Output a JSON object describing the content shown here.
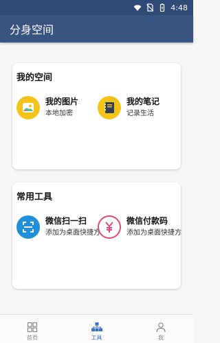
{
  "status_bar": {
    "time": "4:48",
    "icons": [
      "wifi-icon",
      "no-sim-icon",
      "battery-icon"
    ]
  },
  "app_bar": {
    "title": "分身空间"
  },
  "my_space": {
    "title": "我的空间",
    "items": [
      {
        "title": "我的图片",
        "subtitle": "本地加密",
        "icon": "photo-icon",
        "color": "#f3c318"
      },
      {
        "title": "我的笔记",
        "subtitle": "记录生活",
        "icon": "notebook-icon",
        "color": "#f3c318"
      }
    ]
  },
  "common_tools": {
    "title": "常用工具",
    "items": [
      {
        "title": "微信扫一扫",
        "subtitle": "添加为桌面快捷方",
        "icon": "scan-icon",
        "color": "#1e8fd8"
      },
      {
        "title": "微信付款码",
        "subtitle": "添加为桌面快捷方",
        "icon": "payment-code-icon",
        "color": "#e0457b"
      }
    ]
  },
  "bottom_nav": {
    "items": [
      {
        "label": "首页",
        "icon": "home-grid-icon",
        "active": false
      },
      {
        "label": "工具",
        "icon": "tools-icon",
        "active": true
      },
      {
        "label": "我",
        "icon": "user-icon",
        "active": false
      }
    ]
  },
  "colors": {
    "status_bar": "#2f4a77",
    "app_bar": "#3a5482",
    "accent": "#3b6fc2",
    "background": "#f6f6f6"
  }
}
